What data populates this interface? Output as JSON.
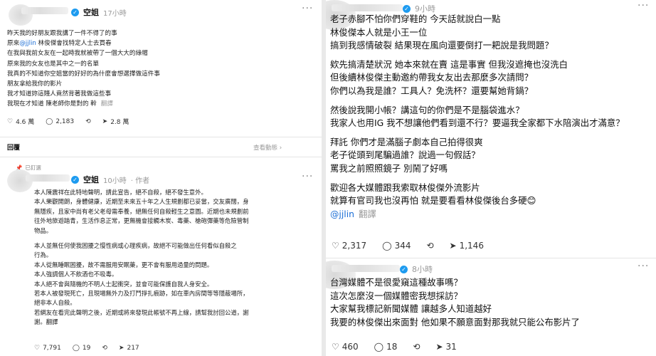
{
  "left": {
    "post1": {
      "name": "空姐",
      "time": "17小時",
      "lines": [
        "昨天我的好朋友跟我講了一件不得了的事",
        "原來@jjlin 林俊傑會找特定人士去買春",
        "在我與我前女友在一起時我就被帶了一個大大的綠帽",
        "原來我的女友也是其中之一的名單",
        "我真的不知道你空姐當的好好的為什麼會想選擇做這件事",
        "朋友拿給我你的影片",
        "我才知道妳這賤人竟然背著我做這些事",
        "我現在才知道 陳老師你是對的 幹"
      ],
      "mention": "@jjlin",
      "translate": "翻譯",
      "likes": "4.6 萬",
      "comments": "2,183",
      "reposts": "",
      "shares": "2.8 萬"
    },
    "reply_label": "回覆",
    "view_activity": "查看動態 ›",
    "pinned_label": "已釘選",
    "post2": {
      "name": "空姐",
      "time": "10小時",
      "author_tag": "作者",
      "lines": [
        "本人陳震祥在此特地聲明，請此宣告，絕不自殺，絕不發生意外。",
        "本人樂觀開朗，身體健康，近期至未來五十年之人生規劃都已妥當，交友廣闊，身",
        "無隱疾，且家中尚有老父老母需奉養，絕無任何自殺輕生之意圖。近期也未規劃前",
        "往外地旅遊踏青，生活作息正常，更無機會接觸木炭、毒藥、槍砲彈藥等危險管制",
        "物品。",
        "",
        "本人並無任何使我困擾之慢性病或心理疾病，故絕不可能做出任何看似自殺之",
        "行為。",
        "本人從無睡眠困擾，故不需服用安眠藥，更不會有服用過量的問題。",
        "本人強調個人不飲酒也不吸毒。",
        "本人絕不會與隨機的不明人士起衝突，並會可能保護自我人身安全。",
        "若本人被發現死亡，且現場無外力及打鬥掙扎痕跡，如在車內房間等等隱蔽場所，",
        "絕非本人自殺。",
        "若網友在看完此聲明之後，近期或將來發現此帳號不再上線，請幫我討回公道，謝",
        "謝。翻譯"
      ],
      "likes": "7,791",
      "comments": "19",
      "reposts": "",
      "shares": "217"
    }
  },
  "right": {
    "post1": {
      "time": "9小時",
      "lines": [
        "老子赤腳不怕你們穿鞋的 今天話就說白一點",
        "林俊傑本人就是小王一位",
        "搞到我感情破裂 結果現在風向還要倒打一耙說是我問題？",
        "",
        "欸先搞清楚狀況 她本來就在賣 這是事實 但我沒遮掩也沒洗白",
        "但後續林俊傑主動邀約帶我女友出去那麼多次請問？",
        "你們以為我是誰？工具人？免洗杯？還要幫她背鍋？",
        "",
        "然後說我開小帳？講這句的你們是不是腦袋進水？",
        "我家人也用IG 我不想讓他們看到還不行？要逼我全家都下水陪演出才滿意？",
        "",
        "拜託 你們才是滿腦子劇本自己拍得很爽",
        "老子從頭到尾騙過誰？說過一句假話？",
        "罵我之前照照鏡子 別鬧了好嗎",
        "",
        "歡迎各大媒體跟我索取林俊傑外流影片",
        "就算有官司我也沒再怕 就是要看看林俊傑後台多硬😊"
      ],
      "mention": "@jjlin",
      "translate": "翻譯",
      "likes": "2,317",
      "comments": "344",
      "reposts": "",
      "shares": "1,146"
    },
    "post2": {
      "time": "8小時",
      "lines": [
        "台灣媒體不是很愛窺這種故事嗎？",
        "這次怎麼沒一個媒體密我想採訪？",
        "大家幫我標記新聞媒體 讓越多人知道越好",
        "我要的林俊傑出來面對 他如果不願意面對那我就只能公布影片了"
      ],
      "likes": "460",
      "comments": "18",
      "reposts": "",
      "shares": "31"
    }
  },
  "colors": {
    "verified": "#1d9bf0",
    "mention": "#1d6fd6",
    "muted": "#999999"
  },
  "icons": [
    "heart-icon",
    "comment-icon",
    "repost-icon",
    "share-icon",
    "more-icon",
    "verified-icon",
    "pin-icon"
  ]
}
